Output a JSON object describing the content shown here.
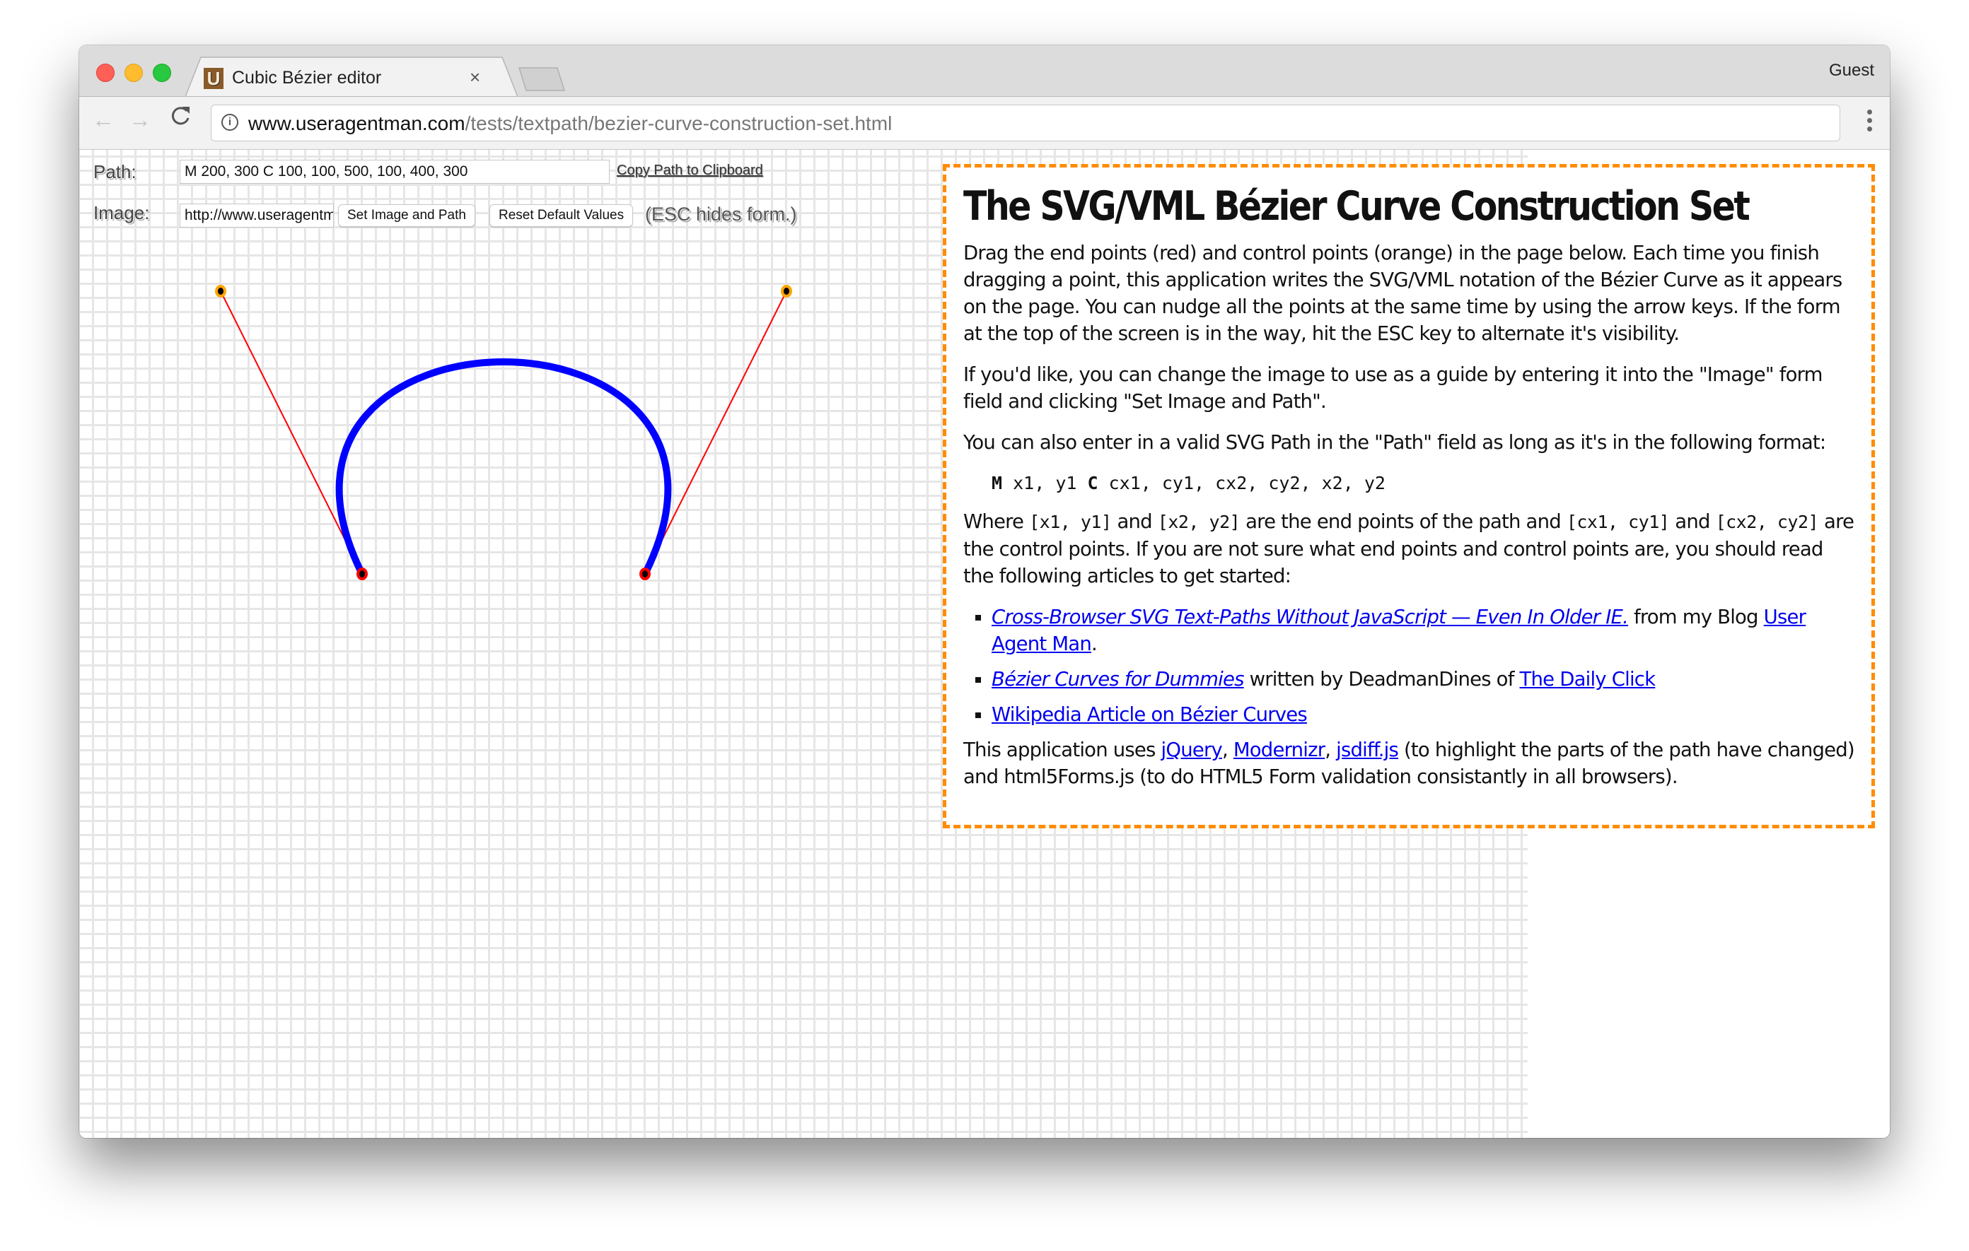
{
  "browser": {
    "tab_title": "Cubic Bézier editor",
    "tab_favicon_letter": "U",
    "tab_close": "×",
    "profile": "Guest",
    "url_host": "www.useragentman.com",
    "url_path": "/tests/textpath/bezier-curve-construction-set.html",
    "back_glyph": "←",
    "forward_glyph": "→",
    "reload_glyph": "C",
    "info_glyph": "i"
  },
  "form": {
    "path_label": "Path:",
    "path_value": "M 200, 300 C 100, 100, 500, 100, 400, 300",
    "copy_link": "Copy Path to Clipboard",
    "image_label": "Image:",
    "image_value": "http://www.useragentman.com/",
    "set_button": "Set Image and Path",
    "reset_button": "Reset Default Values",
    "esc_hint": "(ESC hides form.)"
  },
  "curve": {
    "start": [
      200,
      300
    ],
    "control1": [
      100,
      100
    ],
    "control2": [
      500,
      100
    ],
    "end": [
      400,
      300
    ],
    "colors": {
      "curve": "#0000ff",
      "handle": "#ff0000",
      "end_point": "#ff0000",
      "control_point": "#ffa500"
    }
  },
  "info": {
    "title": "The SVG/VML Bézier Curve Construction Set",
    "p1": "Drag the end points (red) and control points (orange) in the page below. Each time you finish dragging a point, this application writes the SVG/VML notation of the Bézier Curve as it appears on the page. You can nudge all the points at the same time by using the arrow keys. If the form at the top of the screen is in the way, hit the ESC key to alternate it's visibility.",
    "p2": "If you'd like, you can change the image to use as a guide by entering it into the \"Image\" form field and clicking \"Set Image and Path\".",
    "p3": "You can also enter in a valid SVG Path in the \"Path\" field as long as it's in the following format:",
    "format": {
      "m": "M",
      "a": " x1, y1 ",
      "c": "C",
      "b": " cx1, cy1, cx2, cy2, x2, y2"
    },
    "where": {
      "t1": "Where ",
      "c1": "[x1, y1]",
      "t2": " and ",
      "c2": "[x2, y2]",
      "t3": " are the end points of the path and ",
      "c3": "[cx1, cy1]",
      "t4": " and ",
      "c4": "[cx2, cy2]",
      "t5": " are the control points. If you are not sure what end points and control points are, you should read the following articles to get started:"
    },
    "links": [
      {
        "link1": "Cross-Browser SVG Text-Paths Without JavaScript — Even In Older IE.",
        "text": " from my Blog ",
        "link2": "User Agent Man",
        "tail": "."
      },
      {
        "link1": "Bézier Curves for Dummies",
        "text": " written by DeadmanDines of ",
        "link2": "The Daily Click",
        "tail": ""
      },
      {
        "link1": "Wikipedia Article on Bézier Curves",
        "text": "",
        "link2": "",
        "tail": ""
      }
    ],
    "footer": {
      "t1": "This application uses ",
      "l1": "jQuery",
      "s1": ", ",
      "l2": "Modernizr",
      "s2": ", ",
      "l3": "jsdiff.js",
      "t2": " (to highlight the parts of the path have changed) and html5Forms.js (to do HTML5 Form validation consistantly in all browsers)."
    }
  }
}
